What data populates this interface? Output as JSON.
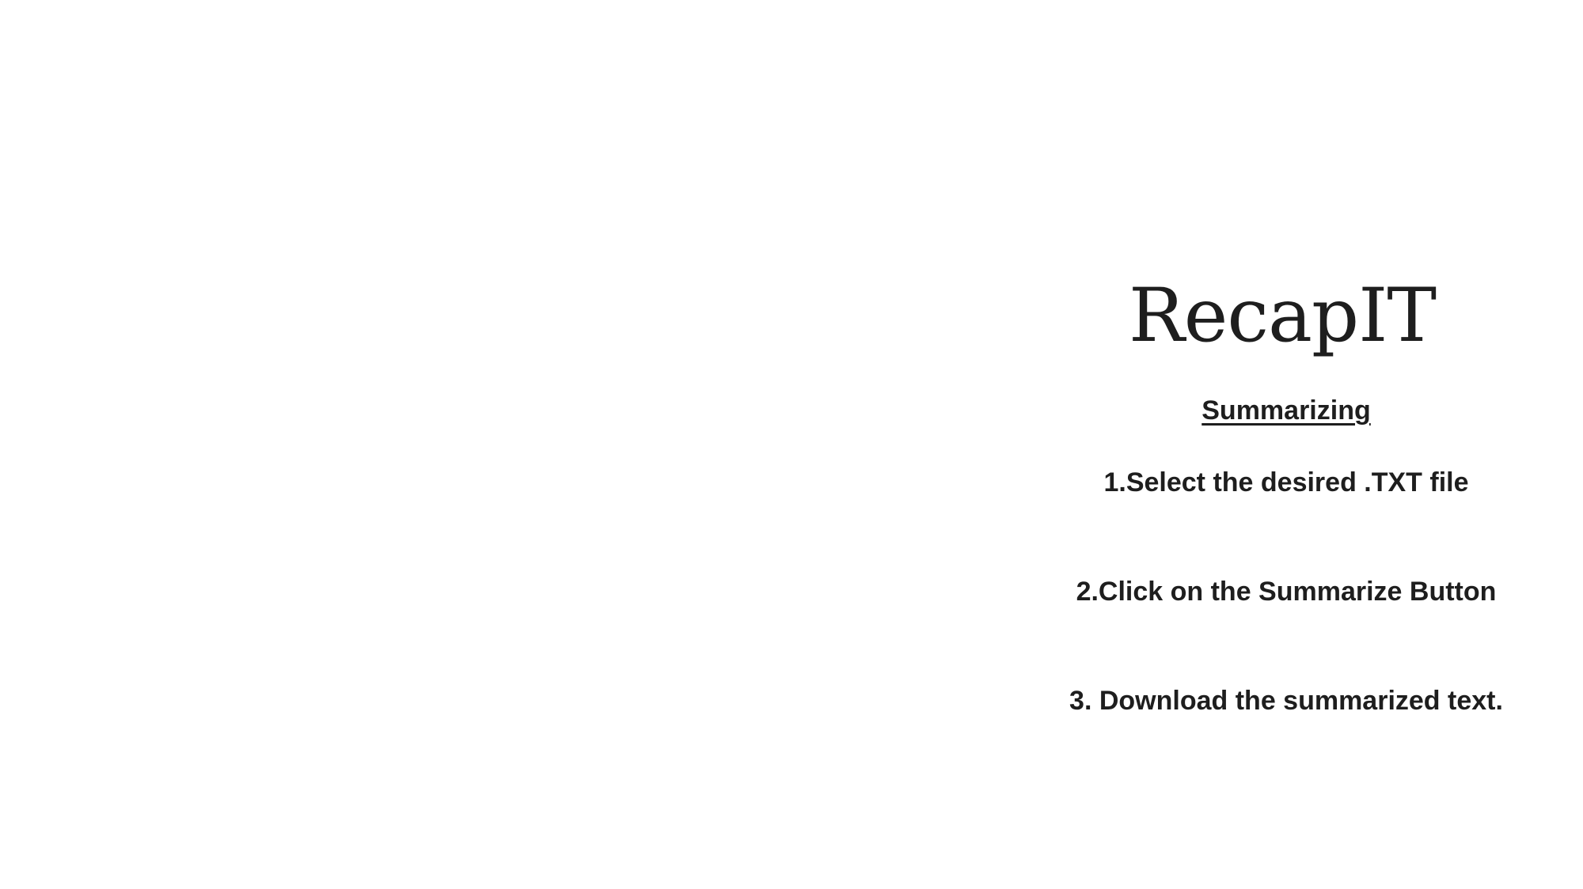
{
  "slide": {
    "title": "RecapIT",
    "subtitle": "Summarizing",
    "steps": [
      "1.Select the desired .TXT file",
      "2.Click on the Summarize Button",
      "3. Download the summarized text."
    ]
  },
  "colors": {
    "background": "#ffffff",
    "text": "#1e1e1e"
  }
}
